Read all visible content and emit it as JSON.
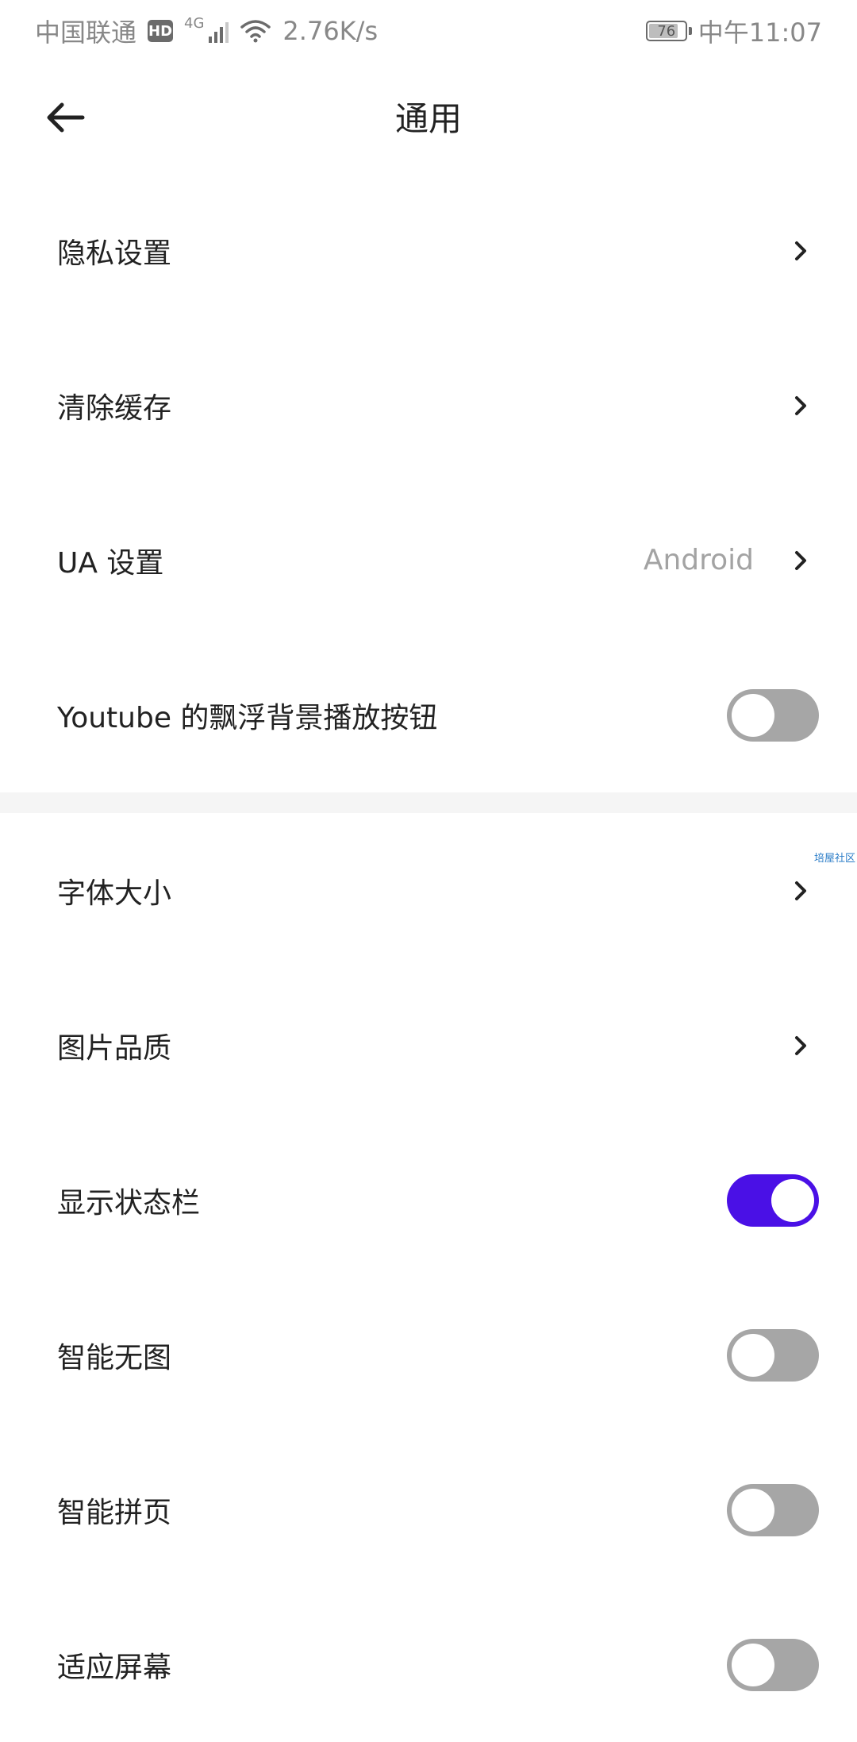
{
  "status_bar": {
    "carrier": "中国联通",
    "hd": "HD",
    "network": "4G",
    "speed": "2.76K/s",
    "battery": "76",
    "time": "中午11:07"
  },
  "header": {
    "title": "通用"
  },
  "section1": [
    {
      "label": "隐私设置",
      "type": "link"
    },
    {
      "label": "清除缓存",
      "type": "link"
    },
    {
      "label": "UA 设置",
      "value": "Android",
      "type": "link"
    },
    {
      "label": "Youtube 的飘浮背景播放按钮",
      "type": "toggle",
      "on": false
    }
  ],
  "section2": [
    {
      "label": "字体大小",
      "type": "link"
    },
    {
      "label": "图片品质",
      "type": "link"
    },
    {
      "label": "显示状态栏",
      "type": "toggle",
      "on": true
    },
    {
      "label": "智能无图",
      "type": "toggle",
      "on": false
    },
    {
      "label": "智能拼页",
      "type": "toggle",
      "on": false
    },
    {
      "label": "适应屏幕",
      "type": "toggle",
      "on": false
    }
  ],
  "watermark": "培屋社区",
  "colors": {
    "accent": "#4a10e6",
    "toggle_off": "#a6a6a6"
  }
}
